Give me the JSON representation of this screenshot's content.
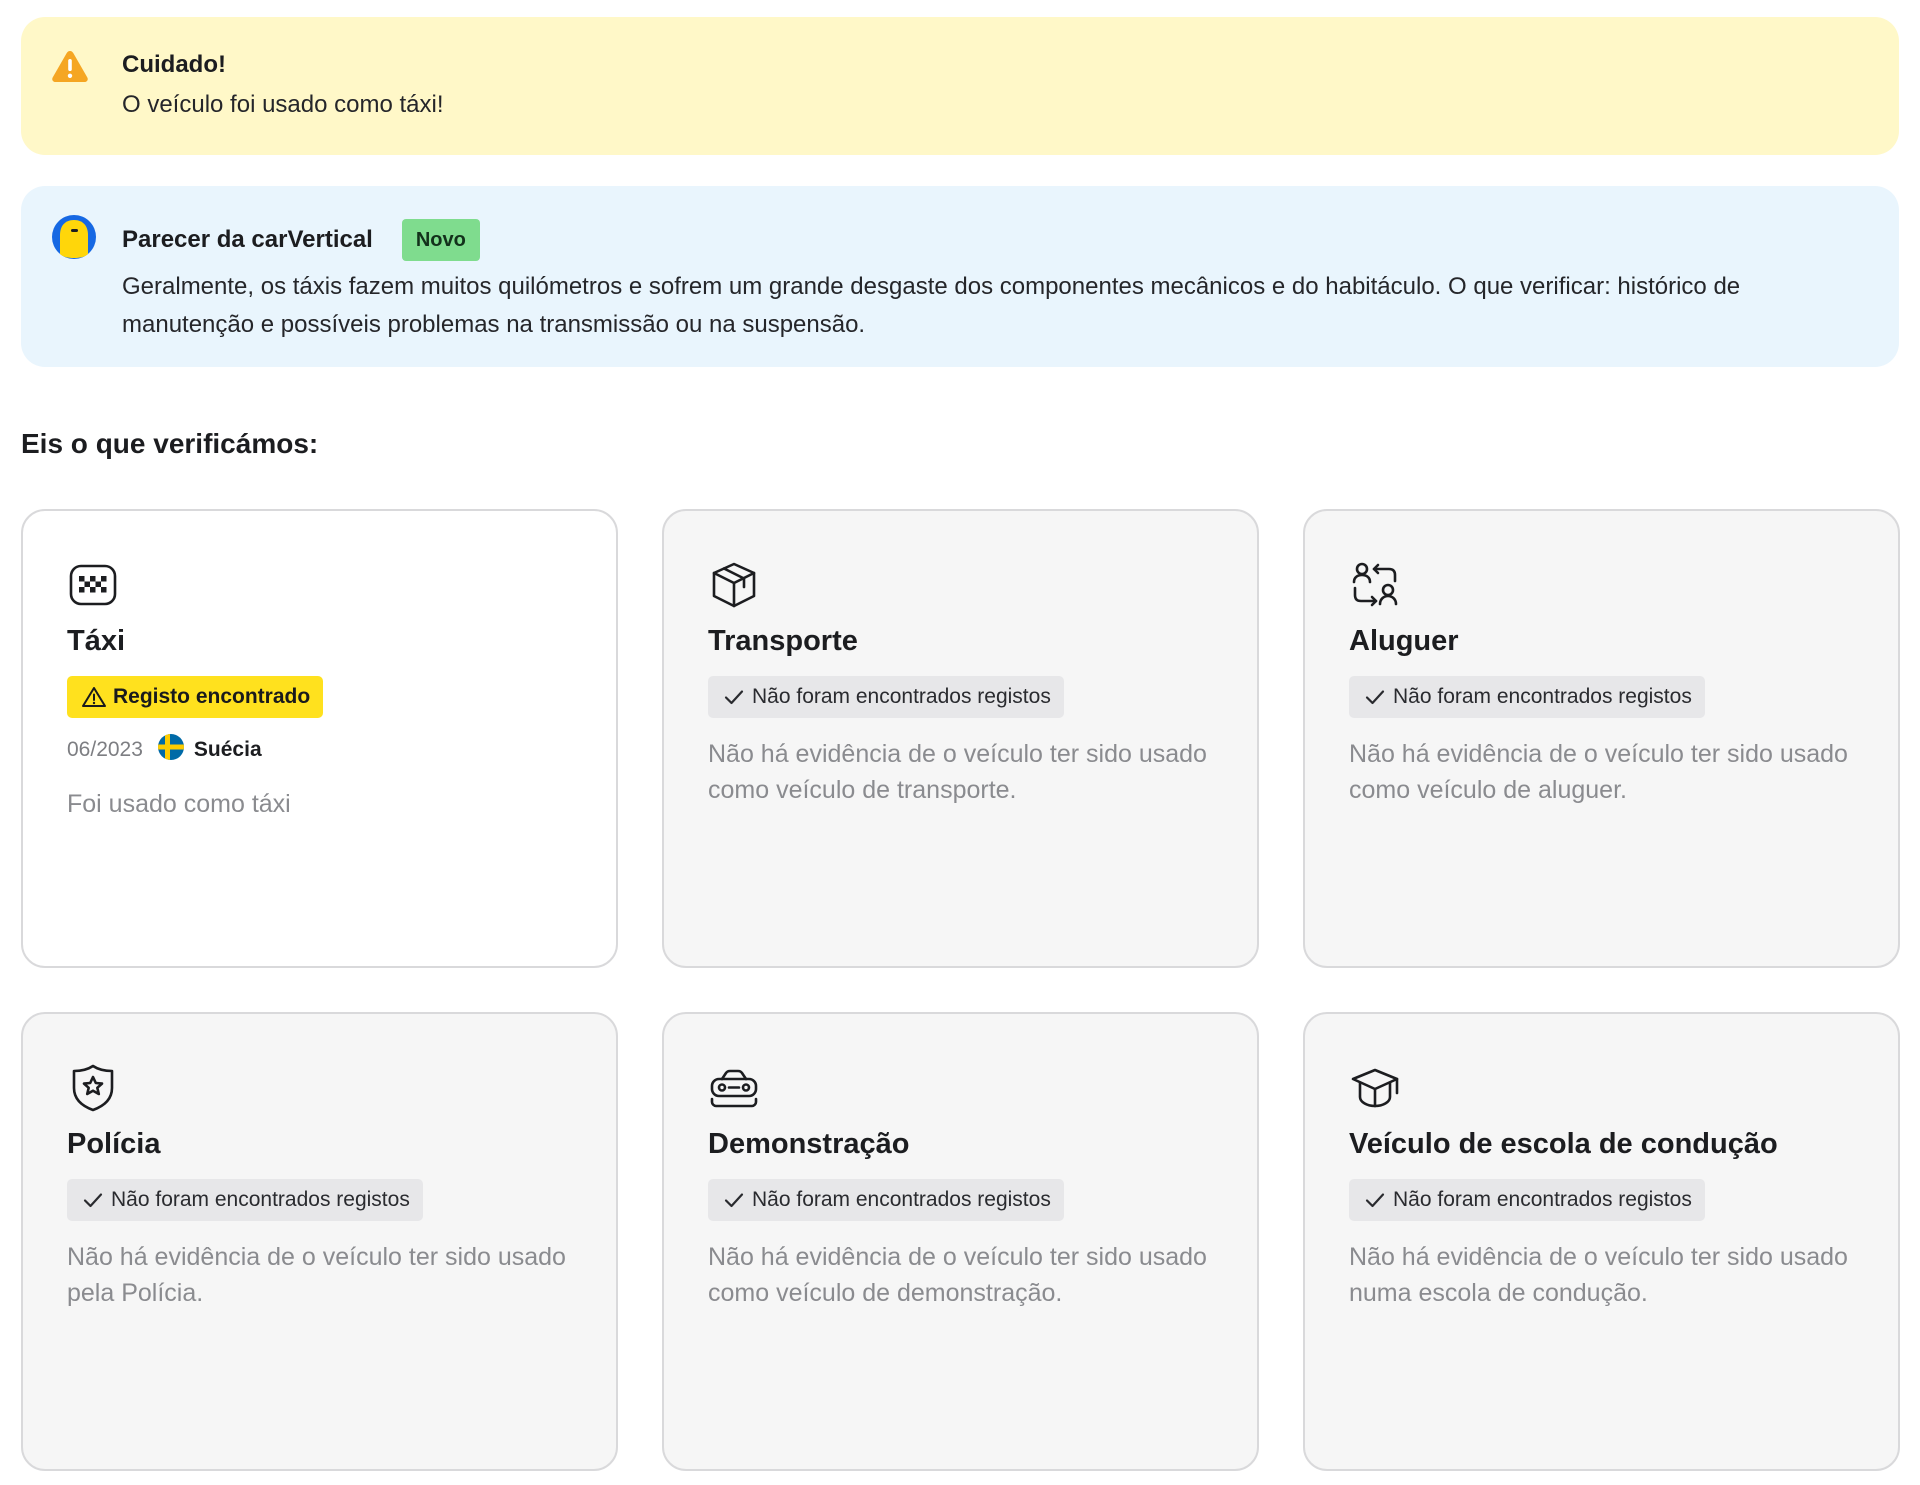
{
  "warning": {
    "icon": "warning-triangle-icon",
    "title": "Cuidado!",
    "text": "O veículo foi usado como táxi!",
    "color": "#f5a623"
  },
  "insight": {
    "icon": "carvertical-logo-icon",
    "title": "Parecer da carVertical",
    "badge": "Novo",
    "text": "Geralmente, os táxis fazem muitos quilómetros e sofrem um grande desgaste dos componentes mecânicos e do habitáculo. O que verificar: histórico de manutenção e possíveis problemas na transmissão ou na suspensão."
  },
  "section_title": "Eis o que verificámos:",
  "cards": [
    {
      "icon": "taxi-sign-icon",
      "title": "Táxi",
      "status": "Registo encontrado",
      "status_type": "found",
      "date": "06/2023",
      "country": "Suécia",
      "country_flag": "sweden-flag-icon",
      "description": "Foi usado como táxi"
    },
    {
      "icon": "package-box-icon",
      "title": "Transporte",
      "status": "Não foram encontrados registos",
      "status_type": "ok",
      "description": "Não há evidência de o veículo ter sido usado como veículo de transporte."
    },
    {
      "icon": "rental-swap-users-icon",
      "title": "Aluguer",
      "status": "Não foram encontrados registos",
      "status_type": "ok",
      "description": "Não há evidência de o veículo ter sido usado como veículo de aluguer."
    },
    {
      "icon": "police-badge-icon",
      "title": "Polícia",
      "status": "Não foram encontrados registos",
      "status_type": "ok",
      "description": "Não há evidência de o veículo ter sido usado pela Polícia."
    },
    {
      "icon": "demo-car-icon",
      "title": "Demonstração",
      "status": "Não foram encontrados registos",
      "status_type": "ok",
      "description": "Não há evidência de o veículo ter sido usado como veículo de demonstração."
    },
    {
      "icon": "graduation-cap-icon",
      "title": "Veículo de escola de condução",
      "status": "Não foram encontrados registos",
      "status_type": "ok",
      "description": "Não há evidência de o veículo ter sido usado numa escola de condução."
    }
  ]
}
